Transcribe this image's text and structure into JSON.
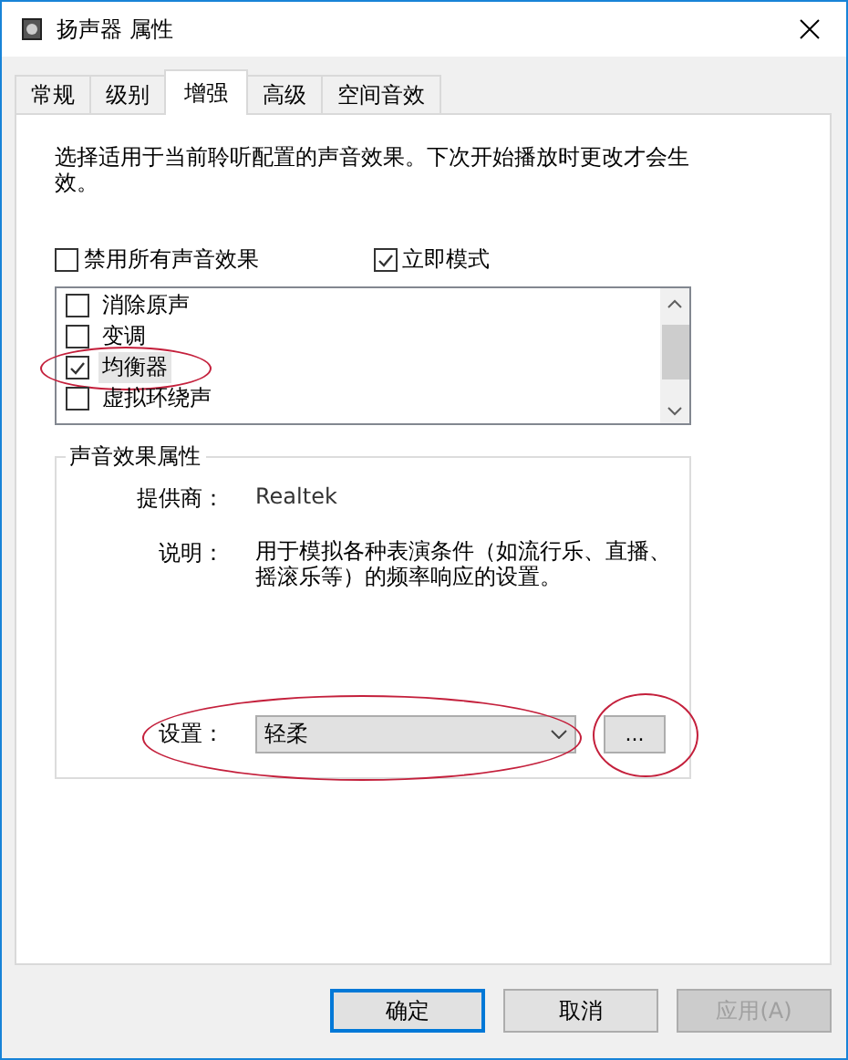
{
  "window": {
    "title": "扬声器 属性"
  },
  "tabs": [
    {
      "label": "常规",
      "selected": false
    },
    {
      "label": "级别",
      "selected": false
    },
    {
      "label": "增强",
      "selected": true
    },
    {
      "label": "高级",
      "selected": false
    },
    {
      "label": "空间音效",
      "selected": false
    }
  ],
  "intro": "选择适用于当前聆听配置的声音效果。下次开始播放时更改才会生效。",
  "options": [
    {
      "label": "禁用所有声音效果",
      "checked": false
    },
    {
      "label": "立即模式",
      "checked": true
    }
  ],
  "effects": [
    {
      "label": "消除原声",
      "checked": false,
      "selected": false,
      "circled": false
    },
    {
      "label": "变调",
      "checked": false,
      "selected": false,
      "circled": false
    },
    {
      "label": "均衡器",
      "checked": true,
      "selected": true,
      "circled": true
    },
    {
      "label": "虚拟环绕声",
      "checked": false,
      "selected": false,
      "circled": false
    }
  ],
  "properties": {
    "title": "声音效果属性",
    "provider_label": "提供商：",
    "provider": "Realtek",
    "description_label": "说明：",
    "description": "用于模拟各种表演条件（如流行乐、直播、摇滚乐等）的频率响应的设置。",
    "setting_label": "设置：",
    "setting_value": "轻柔",
    "setting_circled": true,
    "more_button": {
      "label": "...",
      "circled": true
    }
  },
  "buttons": [
    {
      "label": "确定",
      "kind": "default",
      "disabled": false
    },
    {
      "label": "取消",
      "kind": "normal",
      "disabled": false
    },
    {
      "label": "应用(A)",
      "kind": "normal",
      "disabled": true
    }
  ]
}
